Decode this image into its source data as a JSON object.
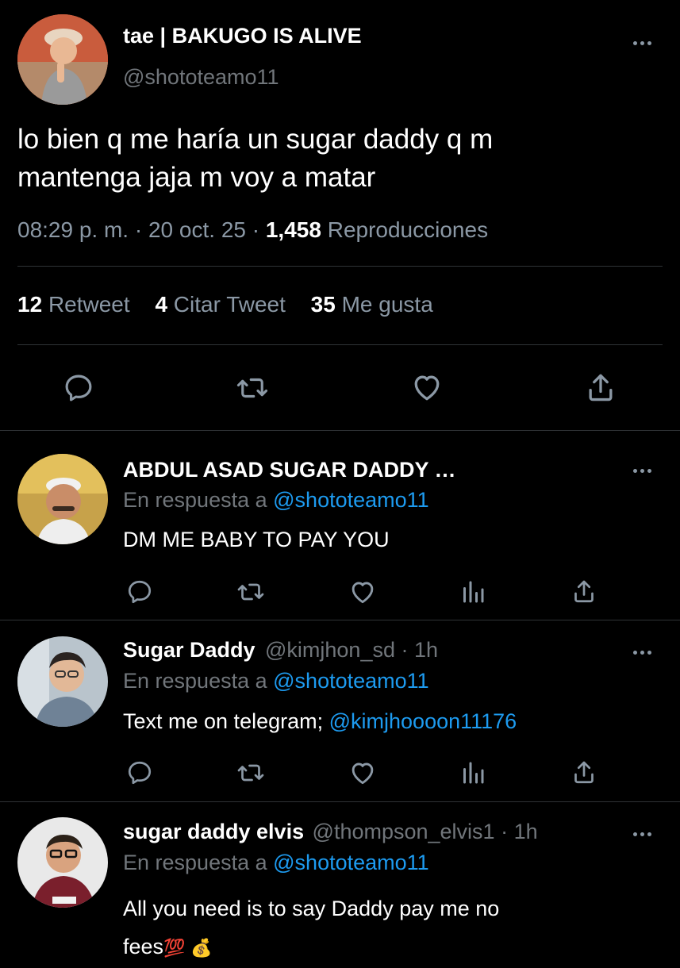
{
  "tweet": {
    "display_name": "tae | BAKUGO IS ALIVE",
    "handle": "@shototeamo11",
    "text_line1": "lo bien q me haría un sugar daddy q m",
    "text_line2": "mantenga jaja m voy a matar",
    "time": "08:29 p. m.",
    "date": "20 oct. 25",
    "views_count": "1,458",
    "views_label": "Reproducciones",
    "separator": "·",
    "stats": {
      "retweets_count": "12",
      "retweets_label": "Retweet",
      "quotes_count": "4",
      "quotes_label": "Citar Tweet",
      "likes_count": "35",
      "likes_label": "Me gusta"
    }
  },
  "replies": [
    {
      "display_name": "ABDUL ASAD SUGAR DADDY …",
      "reply_prefix": "En respuesta a",
      "reply_to": "@shototeamo11",
      "text": "DM ME BABY TO PAY YOU"
    },
    {
      "display_name": "Sugar Daddy",
      "handle_time": "@kimjhon_sd · 1h",
      "reply_prefix": "En respuesta a",
      "reply_to": "@shototeamo11",
      "text_prefix": "Text me on telegram; ",
      "text_link": "@kimjhoooon11176"
    },
    {
      "display_name": "sugar daddy elvis",
      "handle_time": "@thompson_elvis1 · 1h",
      "reply_prefix": "En respuesta a",
      "reply_to": "@shototeamo11",
      "text_line1": "All you need is to say Daddy pay me no",
      "text_line2": "fees",
      "emoji": "💯 💰"
    }
  ],
  "icons": [
    "reply-icon",
    "retweet-icon",
    "like-icon",
    "share-icon",
    "views-icon",
    "more-icon"
  ],
  "colors": {
    "background": "#000000",
    "text": "#e7e9ea",
    "muted": "#71767b",
    "link": "#1d9bf0",
    "divider": "#2f3336"
  }
}
